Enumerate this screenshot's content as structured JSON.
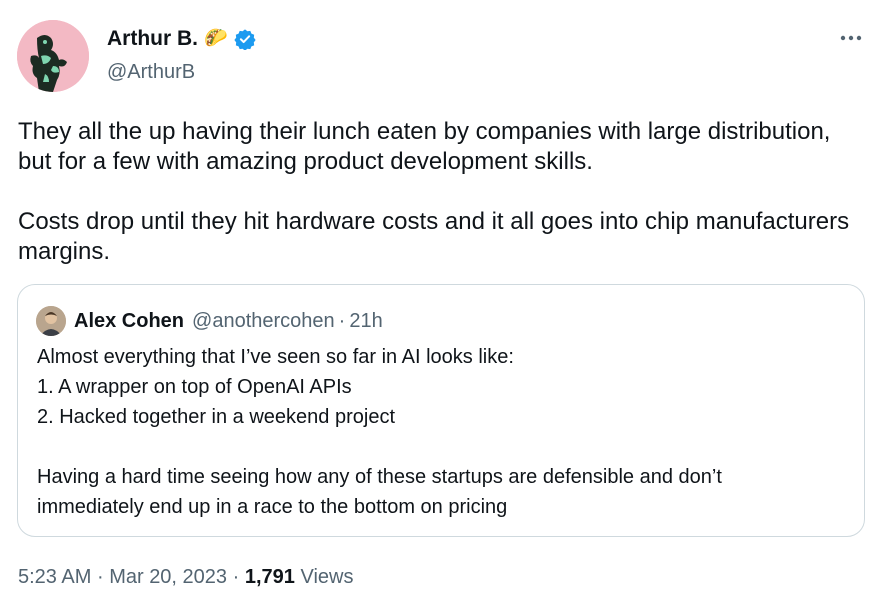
{
  "author": {
    "name": "Arthur B.",
    "emoji": "🌮",
    "handle": "@ArthurB"
  },
  "tweet": {
    "paragraphs": [
      "They all the up having their lunch eaten by companies with large distribution, but for a few with amazing product development skills.",
      "Costs drop until they hit hardware costs and it all goes into chip manufacturers margins."
    ]
  },
  "quote": {
    "name": "Alex Cohen",
    "handle": "@anothercohen",
    "separator": "·",
    "time": "21h",
    "lines": [
      "Almost everything that I’ve seen so far in AI looks like:",
      "1. A wrapper on top of OpenAI APIs",
      "2. Hacked together in a weekend project",
      "",
      "Having a hard time seeing how any of these startups are defensible and don’t",
      "immediately end up in a race to the bottom on pricing"
    ]
  },
  "meta": {
    "time": "5:23 AM",
    "separator": "·",
    "date": "Mar 20, 2023",
    "views_count": "1,791",
    "views_label": "Views"
  },
  "colors": {
    "verified_badge": "#1d9bf0",
    "secondary_text": "#536471",
    "border": "#cfd9de"
  }
}
